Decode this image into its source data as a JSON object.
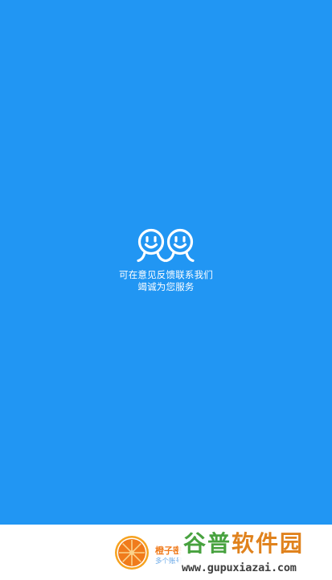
{
  "splash": {
    "background_color": "#2196f3",
    "logo_icon": "two-smiling-faces-icon",
    "message_line1": "可在意见反馈联系我们",
    "message_line2": "竭诚为您服务"
  },
  "footer": {
    "app_icon": "orange-slice-icon",
    "app_name": "橙子密",
    "app_tagline": "多个账号",
    "accent_color": "#f07b1c"
  },
  "watermark": {
    "part1": "谷普",
    "part2": "软件园",
    "url": "www.gupuxiazai.com"
  }
}
